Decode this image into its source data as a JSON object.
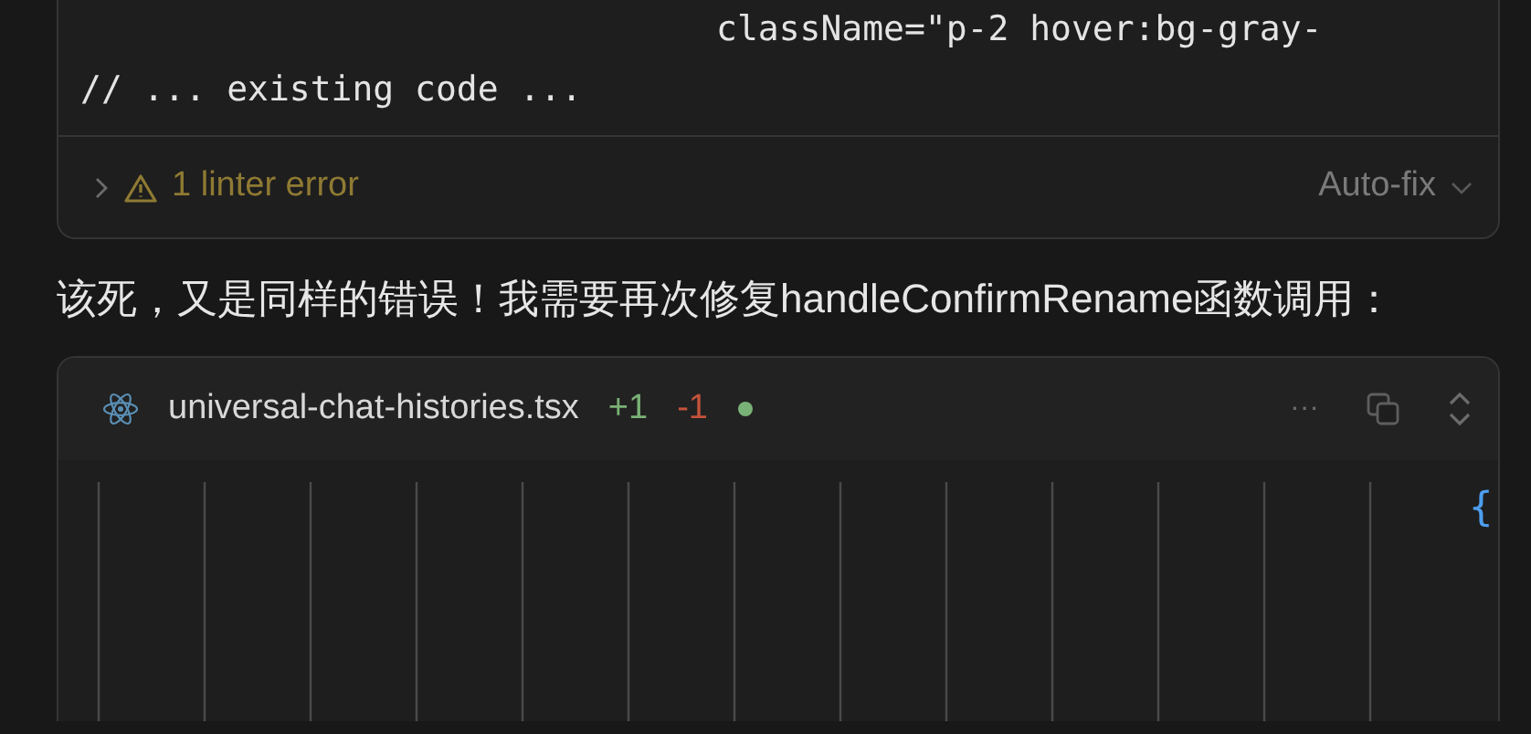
{
  "top_code_block": {
    "lines": [
      {
        "text": "className=\"p-2 hover:bg-gray-",
        "indent": true
      },
      {
        "text": "// ... existing code ...",
        "indent": false
      }
    ],
    "linter": {
      "expanded": false,
      "label": "1 linter error"
    },
    "autofix": {
      "label": "Auto-fix"
    }
  },
  "message": "该死，又是同样的错误！我需要再次修复handleConfirmRename函数调用：",
  "diff_block": {
    "filename": "universal-chat-histories.tsx",
    "added": "+1",
    "removed": "-1",
    "more": "···",
    "code_lines": [
      {
        "text": "{"
      }
    ]
  }
}
